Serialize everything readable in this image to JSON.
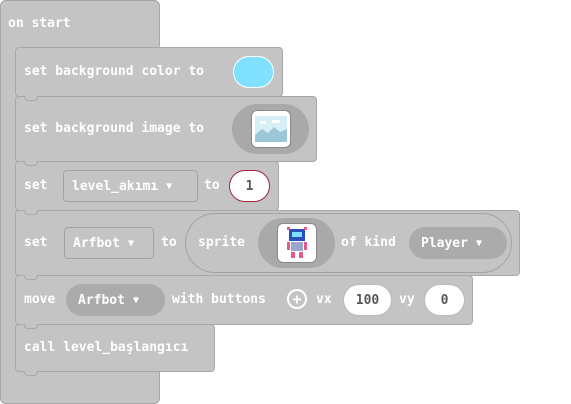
{
  "on_start": {
    "label": "on start"
  },
  "set_bg_color": {
    "label": "set background color to",
    "color": "#7fe0ff"
  },
  "set_bg_image": {
    "label": "set background image to"
  },
  "set_variable": {
    "set_label": "set",
    "variable": "level_akımı",
    "to_label": "to",
    "value": "1"
  },
  "set_sprite": {
    "set_label": "set",
    "variable": "Arfbot",
    "to_label": "to",
    "sprite_label": "sprite",
    "of_kind_label": "of kind",
    "kind": "Player"
  },
  "move": {
    "move_label": "move",
    "sprite": "Arfbot",
    "with_label": "with buttons",
    "vx_label": "vx",
    "vx": "100",
    "vy_label": "vy",
    "vy": "0"
  },
  "call": {
    "label": "call level_başlangıcı"
  },
  "icons": {
    "add": "plus-circle-icon",
    "caret": "caret-down-icon"
  }
}
